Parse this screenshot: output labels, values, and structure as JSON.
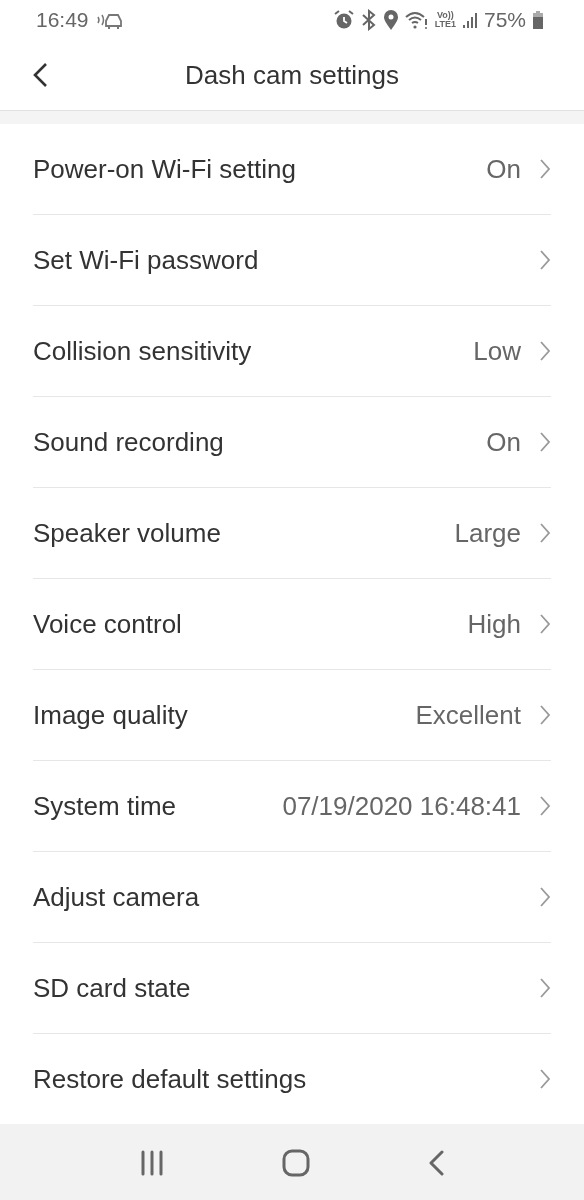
{
  "status_bar": {
    "time": "16:49",
    "volte_top": "Vo))",
    "volte_bottom": "LTE1",
    "battery": "75%"
  },
  "header": {
    "title": "Dash cam settings"
  },
  "settings": [
    {
      "label": "Power-on Wi-Fi setting",
      "value": "On"
    },
    {
      "label": "Set Wi-Fi password"
    },
    {
      "label": "Collision sensitivity",
      "value": "Low"
    },
    {
      "label": "Sound recording",
      "value": "On"
    },
    {
      "label": "Speaker volume",
      "value": "Large"
    },
    {
      "label": "Voice control",
      "value": "High"
    },
    {
      "label": "Image quality",
      "value": "Excellent"
    },
    {
      "label": "System time",
      "value": "07/19/2020 16:48:41"
    },
    {
      "label": "Adjust camera"
    },
    {
      "label": "SD card state"
    },
    {
      "label": "Restore default settings"
    }
  ]
}
